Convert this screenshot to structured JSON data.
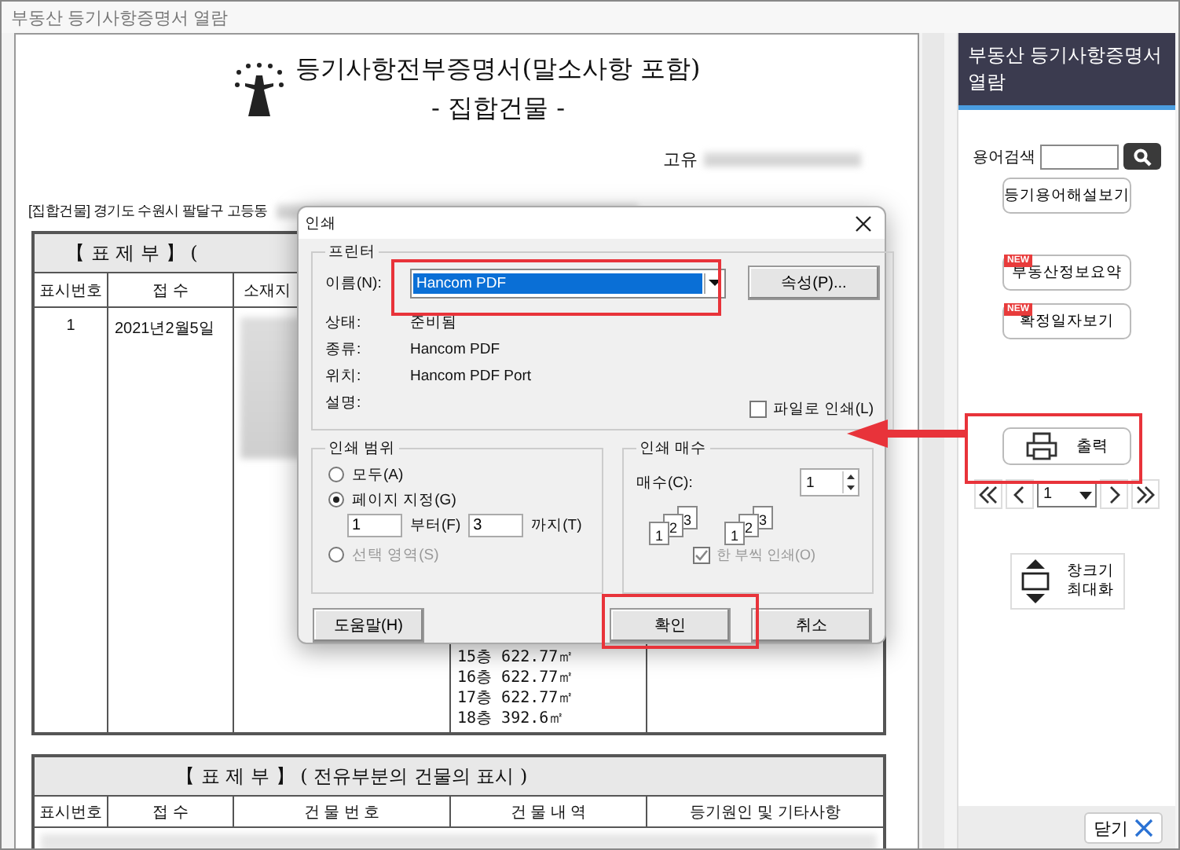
{
  "window": {
    "title": "부동산 등기사항증명서 열람"
  },
  "document": {
    "title": "등기사항전부증명서(말소사항 포함)",
    "subtitle": "- 집합건물 -",
    "unique_number_label": "고유",
    "address_line": "[집합건물] 경기도 수원시 팔달구 고등동",
    "table_1": {
      "heading": "【 표 제 부 】 (",
      "columns": [
        "표시번호",
        "접 수",
        "소재지"
      ],
      "rows": [
        {
          "number": "1",
          "received": "2021년2월5일"
        }
      ],
      "floor_areas": [
        "15층  622.77㎡",
        "16층  622.77㎡",
        "17층  622.77㎡",
        "18층  392.6㎡"
      ]
    },
    "table_2": {
      "heading": "【 표 제 부 】 ( 전유부분의 건물의 표시 )",
      "columns": [
        "표시번호",
        "접 수",
        "건 물 번 호",
        "건 물 내 역",
        "등기원인 및 기타사항"
      ]
    }
  },
  "print_dialog": {
    "title": "인쇄",
    "printer": {
      "legend": "프린터",
      "name_label": "이름(N):",
      "name_value": "Hancom PDF",
      "properties_button": "속성(P)...",
      "info": [
        {
          "label": "상태:",
          "value": "준비됨"
        },
        {
          "label": "종류:",
          "value": "Hancom PDF"
        },
        {
          "label": "위치:",
          "value": "Hancom PDF Port"
        },
        {
          "label": "설명:"
        }
      ],
      "print_to_file": {
        "label": "파일로 인쇄(L)",
        "checked": false
      }
    },
    "range": {
      "legend": "인쇄 범위",
      "options": [
        {
          "label": "모두(A)",
          "selected": false,
          "disabled": false
        },
        {
          "label": "페이지 지정(G)",
          "selected": true,
          "disabled": false
        },
        {
          "label": "선택 영역(S)",
          "selected": false,
          "disabled": true
        }
      ],
      "from_value": "1",
      "from_label": "부터(F)",
      "to_value": "3",
      "to_label": "까지(T)"
    },
    "copies": {
      "legend": "인쇄 매수",
      "count_label": "매수(C):",
      "count_value": "1",
      "page_stacks": [
        [
          "1",
          "2",
          "3"
        ],
        [
          "1",
          "2",
          "3"
        ]
      ],
      "collate": {
        "label": "한 부씩 인쇄(O)",
        "checked": true,
        "disabled": true
      }
    },
    "buttons": {
      "help": "도움말(H)",
      "ok": "확인",
      "cancel": "취소"
    }
  },
  "sidebar": {
    "title": "부동산 등기사항증명서 열람",
    "search_label": "용어검색",
    "buttons": [
      {
        "label": "등기용어해설보기"
      },
      {
        "label": "부동산정보요약",
        "badge": "NEW"
      },
      {
        "label": "확정일자보기",
        "badge": "NEW"
      }
    ],
    "print_button": "출력",
    "page_value": "1",
    "maximize_button": [
      "창크기",
      "최대화"
    ],
    "close_button": "닫기"
  }
}
